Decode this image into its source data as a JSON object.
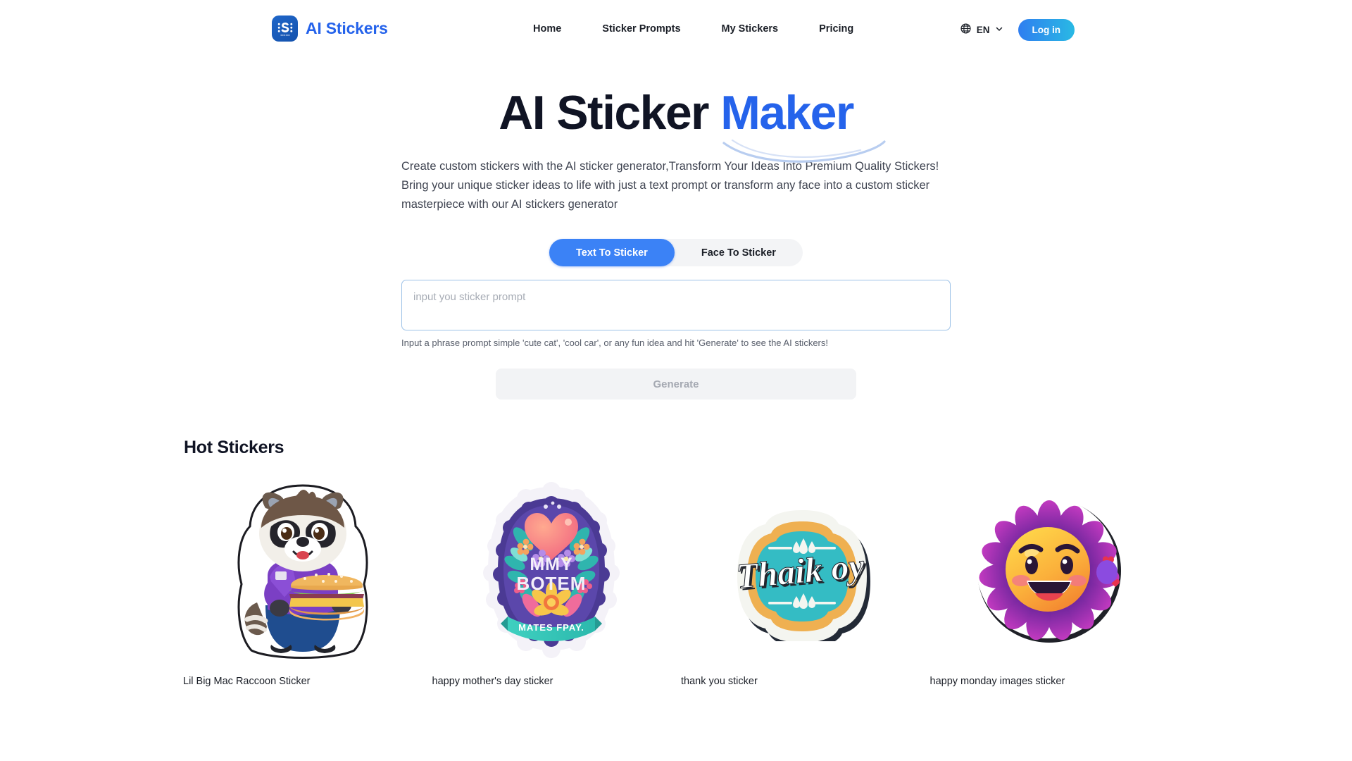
{
  "brand": {
    "name": "AI Stickers",
    "logo_icon": "sticker-s-logo-icon",
    "logo_sub_text": "AI STICKERS",
    "logo_color": "#2563eb"
  },
  "nav": {
    "items": [
      {
        "label": "Home"
      },
      {
        "label": "Sticker Prompts"
      },
      {
        "label": "My Stickers"
      },
      {
        "label": "Pricing"
      }
    ]
  },
  "header_right": {
    "globe_icon": "globe-icon",
    "language": "EN",
    "chevron_icon": "chevron-down-icon",
    "login_label": "Log in",
    "login_gradient_from": "#2f7ef0",
    "login_gradient_to": "#29b9e4"
  },
  "hero": {
    "title_plain": "AI Sticker ",
    "title_accent": "Maker",
    "accent_color": "#2563eb",
    "description": "Create custom stickers with the AI sticker generator,Transform Your Ideas Into Premium Quality Stickers! Bring your unique sticker ideas to life with just a text prompt or transform any face into a custom sticker masterpiece with our AI stickers generator"
  },
  "generator": {
    "tabs": [
      {
        "label": "Text To Sticker",
        "active": true
      },
      {
        "label": "Face To Sticker",
        "active": false
      }
    ],
    "active_tab_color": "#3b82f6",
    "prompt_value": "",
    "prompt_placeholder": "input you sticker prompt",
    "hint": "Input a phrase prompt simple 'cute cat', 'cool car', or any fun idea and hit 'Generate' to see the AI stickers!",
    "generate_label": "Generate",
    "generate_disabled": true
  },
  "hot_stickers": {
    "title": "Hot Stickers",
    "items": [
      {
        "label": "Lil Big Mac Raccoon Sticker",
        "art": "raccoon-burger-sticker"
      },
      {
        "label": "happy mother's day sticker",
        "art": "mothers-day-heart-sticker"
      },
      {
        "label": "thank you sticker",
        "art": "thank-you-badge-sticker"
      },
      {
        "label": "happy monday images sticker",
        "art": "smiling-sun-flower-sticker"
      }
    ]
  }
}
